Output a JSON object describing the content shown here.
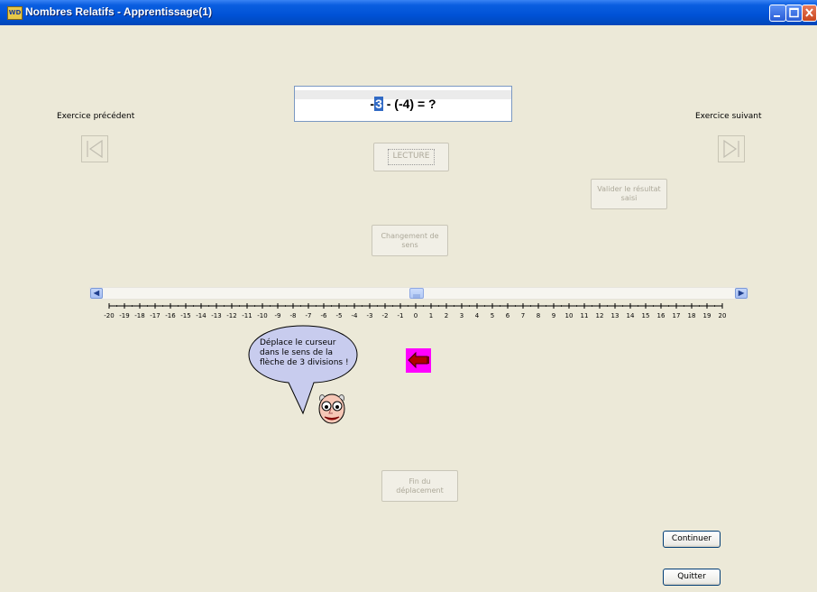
{
  "window": {
    "title": "Nombres Relatifs - Apprentissage(1)",
    "icon_text": "WD"
  },
  "nav": {
    "prev_label": "Exercice précédent",
    "next_label": "Exercice suivant"
  },
  "equation": {
    "selected": "3",
    "prefix": "-",
    "rest": " - (-4) = ?"
  },
  "buttons": {
    "lecture": "LECTURE",
    "valider": "Valider le résultat saisi",
    "changement": "Changement de sens",
    "fin": "Fin du déplacement",
    "continuer": "Continuer",
    "quitter": "Quitter"
  },
  "scale": {
    "min": -20,
    "max": 20,
    "cursor_value": 0,
    "ticks": [
      "-20",
      "-19",
      "-18",
      "-17",
      "-16",
      "-15",
      "-14",
      "-13",
      "-12",
      "-11",
      "-10",
      "-9",
      "-8",
      "-7",
      "-6",
      "-5",
      "-4",
      "-3",
      "-2",
      "-1",
      "0",
      "1",
      "2",
      "3",
      "4",
      "5",
      "6",
      "7",
      "8",
      "9",
      "10",
      "11",
      "12",
      "13",
      "14",
      "15",
      "16",
      "17",
      "18",
      "19",
      "20"
    ]
  },
  "bubble": {
    "text": "Déplace le curseur dans le sens de la flèche de 3 divisions !"
  },
  "colors": {
    "titlebar": "#0054E3",
    "background": "#ECE9D8",
    "arrow_bg": "#FF00FF",
    "arrow_color": "#B00000",
    "bubble_fill": "#C8CCEE"
  }
}
